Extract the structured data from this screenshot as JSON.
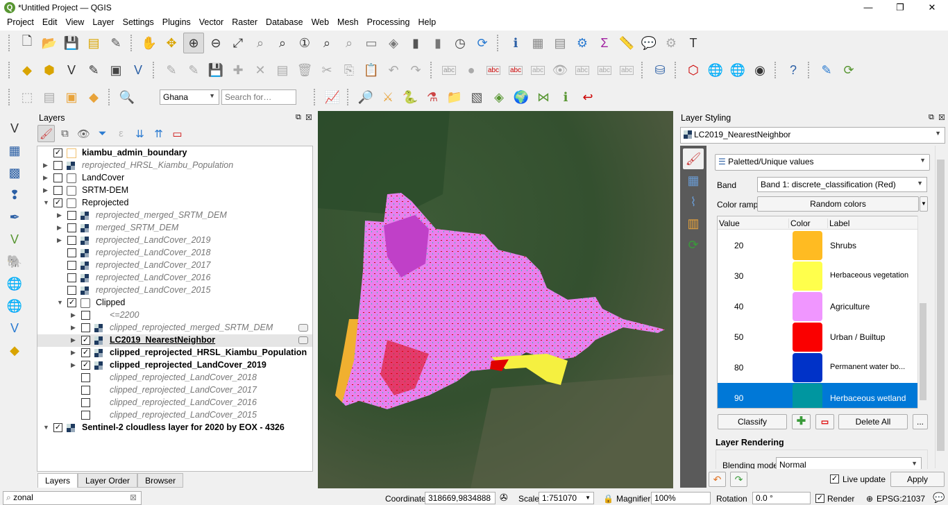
{
  "window": {
    "title": "*Untitled Project — QGIS",
    "minimize": "—",
    "maximize": "❐",
    "close": "✕"
  },
  "menu": [
    "Project",
    "Edit",
    "View",
    "Layer",
    "Settings",
    "Plugins",
    "Vector",
    "Raster",
    "Database",
    "Web",
    "Mesh",
    "Processing",
    "Help"
  ],
  "toolbars": [
    [
      {
        "icon": "new-project-icon",
        "g": "🗋",
        "c": "#333"
      },
      {
        "icon": "open-project-icon",
        "g": "📂",
        "c": "#e8a33a"
      },
      {
        "icon": "save-project-icon",
        "g": "💾",
        "c": "#3b6ea5"
      },
      {
        "icon": "new-print-layout-icon",
        "g": "▤",
        "c": "#d9a400"
      },
      {
        "icon": "layout-manager-icon",
        "g": "✎",
        "c": "#555"
      },
      {
        "sep": 1
      },
      {
        "icon": "pan-icon",
        "g": "✋",
        "c": "#333"
      },
      {
        "icon": "pan-to-selection-icon",
        "g": "✥",
        "c": "#d9a400"
      },
      {
        "icon": "zoom-in-icon",
        "g": "⊕",
        "c": "#333",
        "sel": 1
      },
      {
        "icon": "zoom-out-icon",
        "g": "⊖",
        "c": "#333"
      },
      {
        "icon": "zoom-full-icon",
        "g": "⤢",
        "c": "#333"
      },
      {
        "icon": "zoom-selection-icon",
        "g": "⌕",
        "c": "#888"
      },
      {
        "icon": "zoom-layer-icon",
        "g": "⌕",
        "c": "#333"
      },
      {
        "icon": "zoom-native-icon",
        "g": "①",
        "c": "#333"
      },
      {
        "icon": "zoom-last-icon",
        "g": "⌕",
        "c": "#333"
      },
      {
        "icon": "zoom-next-icon",
        "g": "⌕",
        "c": "#999"
      },
      {
        "icon": "new-map-view-icon",
        "g": "▭",
        "c": "#777"
      },
      {
        "icon": "new-3d-view-icon",
        "g": "◈",
        "c": "#777"
      },
      {
        "icon": "bookmark-icon",
        "g": "▮",
        "c": "#555"
      },
      {
        "icon": "show-bookmarks-icon",
        "g": "▮",
        "c": "#777"
      },
      {
        "icon": "temporal-icon",
        "g": "◷",
        "c": "#444"
      },
      {
        "icon": "refresh-icon",
        "g": "⟳",
        "c": "#2b7bd1"
      },
      {
        "sep": 1
      },
      {
        "icon": "identify-icon",
        "g": "ℹ",
        "c": "#2b5fa5"
      },
      {
        "icon": "attribute-table-icon",
        "g": "▦",
        "c": "#888"
      },
      {
        "icon": "field-calculator-icon",
        "g": "▤",
        "c": "#888"
      },
      {
        "icon": "settings-gear-icon",
        "g": "⚙",
        "c": "#2b7bd1"
      },
      {
        "icon": "statistics-sigma-icon",
        "g": "Σ",
        "c": "#a020a0"
      },
      {
        "icon": "measure-icon",
        "g": "📏",
        "c": "#555"
      },
      {
        "icon": "annotation-icon",
        "g": "💬",
        "c": "#e8d44d"
      },
      {
        "icon": "spatial-query-icon",
        "g": "⚙",
        "c": "#aaa"
      },
      {
        "icon": "text-annotation-icon",
        "g": "T",
        "c": "#333"
      }
    ],
    [
      {
        "icon": "data-source-manager-icon",
        "g": "◆",
        "c": "#d9a400"
      },
      {
        "icon": "new-geopackage-icon",
        "g": "⬢",
        "c": "#d9a400"
      },
      {
        "icon": "digitize-vertex-icon",
        "g": "V",
        "c": "#333"
      },
      {
        "icon": "digitize-icon",
        "g": "✎",
        "c": "#333"
      },
      {
        "icon": "gps-icon",
        "g": "▣",
        "c": "#444"
      },
      {
        "icon": "virtual-layer-icon",
        "g": "V",
        "c": "#2b5fa5"
      },
      {
        "sep": 1
      },
      {
        "icon": "current-edits-icon",
        "g": "✎",
        "c": "#aaa"
      },
      {
        "icon": "toggle-editing-icon",
        "g": "✎",
        "c": "#aaa"
      },
      {
        "icon": "save-edits-icon",
        "g": "💾",
        "c": "#aaa"
      },
      {
        "icon": "add-feature-icon",
        "g": "✚",
        "c": "#aaa"
      },
      {
        "icon": "vertex-tool-icon",
        "g": "✕",
        "c": "#aaa"
      },
      {
        "icon": "modify-attributes-icon",
        "g": "▤",
        "c": "#aaa"
      },
      {
        "icon": "delete-selected-icon",
        "g": "🗑",
        "c": "#aaa"
      },
      {
        "icon": "cut-icon",
        "g": "✂",
        "c": "#aaa"
      },
      {
        "icon": "copy-icon",
        "g": "⎘",
        "c": "#aaa"
      },
      {
        "icon": "paste-icon",
        "g": "📋",
        "c": "#aaa"
      },
      {
        "icon": "undo-icon",
        "g": "↶",
        "c": "#aaa"
      },
      {
        "icon": "redo-icon",
        "g": "↷",
        "c": "#aaa"
      },
      {
        "sep": 1
      },
      {
        "icon": "label-toolbar-icon",
        "g": "abc",
        "c": "#999"
      },
      {
        "icon": "label-pin-icon",
        "g": "●",
        "c": "#aaa"
      },
      {
        "icon": "layer-labeling-icon",
        "g": "abc",
        "c": "#c00"
      },
      {
        "icon": "label-highlight-icon",
        "g": "abc",
        "c": "#c00"
      },
      {
        "icon": "pin-labels-icon",
        "g": "abc",
        "c": "#aaa"
      },
      {
        "icon": "show-hide-labels-icon",
        "g": "👁",
        "c": "#aaa"
      },
      {
        "icon": "move-label-icon",
        "g": "abc",
        "c": "#aaa"
      },
      {
        "icon": "rotate-label-icon",
        "g": "abc",
        "c": "#aaa"
      },
      {
        "icon": "change-label-icon",
        "g": "abc",
        "c": "#aaa"
      },
      {
        "sep": 1
      },
      {
        "icon": "db-manager-icon",
        "g": "⛁",
        "c": "#2b5fa5"
      },
      {
        "sep": 1
      },
      {
        "icon": "topology-checker-icon",
        "g": "⬡",
        "c": "#c00"
      },
      {
        "icon": "geocoding-icon",
        "g": "🌐",
        "c": "#2b7bd1"
      },
      {
        "icon": "zoom-web-icon",
        "g": "🌐",
        "c": "#2b7bd1"
      },
      {
        "icon": "plugin-icon",
        "g": "◉",
        "c": "#333"
      },
      {
        "sep": 1
      },
      {
        "icon": "help-icon",
        "g": "?",
        "c": "#2b5fa5"
      },
      {
        "sep": 1
      },
      {
        "icon": "georeferencer-icon",
        "g": "✎",
        "c": "#2b7bd1"
      },
      {
        "icon": "raster-refresh-icon",
        "g": "⟳",
        "c": "#589632"
      }
    ],
    [
      {
        "icon": "select-features-icon",
        "g": "⬚",
        "c": "#aaa"
      },
      {
        "icon": "select-attribute-icon",
        "g": "▤",
        "c": "#aaa"
      },
      {
        "icon": "deselect-icon",
        "g": "▣",
        "c": "#e8a33a"
      },
      {
        "icon": "select-location-icon",
        "g": "◆",
        "c": "#e8a33a"
      },
      {
        "sep": 1
      },
      {
        "icon": "search-zoom-icon",
        "g": "🔍",
        "c": "#2b7bd1"
      }
    ],
    [
      {
        "icon": "profile-tool-icon",
        "g": "📈",
        "c": "#a020a0"
      },
      {
        "sep": 1
      },
      {
        "icon": "search-plugin-icon",
        "g": "🔎",
        "c": "#589632"
      },
      {
        "icon": "semi-auto-classification-icon",
        "g": "⚔",
        "c": "#e8a33a"
      },
      {
        "icon": "python-console-icon",
        "g": "🐍",
        "c": "#2b5fa5"
      },
      {
        "icon": "processing-model-icon",
        "g": "⚗",
        "c": "#c44"
      },
      {
        "icon": "folder-plugin-icon",
        "g": "📁",
        "c": "#e8a33a"
      },
      {
        "icon": "georef-plugin-icon",
        "g": "▧",
        "c": "#555"
      },
      {
        "icon": "layers-plugin-icon",
        "g": "◈",
        "c": "#589632"
      },
      {
        "icon": "earth-engine-icon",
        "g": "🌍",
        "c": "#2b5fa5"
      },
      {
        "icon": "bowtie-icon",
        "g": "⋈",
        "c": "#589632"
      },
      {
        "icon": "identify-plugin-icon",
        "g": "ℹ",
        "c": "#589632"
      },
      {
        "icon": "curve-plugin-icon",
        "g": "↩",
        "c": "#c00"
      }
    ]
  ],
  "search_toolbar": {
    "location": "Ghana",
    "search_placeholder": "Search for…"
  },
  "left_toolbar": [
    {
      "icon": "add-vector-layer-icon",
      "g": "V",
      "c": "#333"
    },
    {
      "icon": "add-raster-layer-icon",
      "g": "▦",
      "c": "#2b5fa5"
    },
    {
      "icon": "add-mesh-layer-icon",
      "g": "▩",
      "c": "#2b5fa5"
    },
    {
      "icon": "add-delimited-text-icon",
      "g": "❢",
      "c": "#2b5fa5"
    },
    {
      "icon": "add-spatialite-icon",
      "g": "✒",
      "c": "#2b5fa5"
    },
    {
      "icon": "add-virtual-layer-icon",
      "g": "V",
      "c": "#589632"
    },
    {
      "icon": "add-postgis-icon",
      "g": "🐘",
      "c": "#2b5fa5"
    },
    {
      "icon": "add-wms-icon",
      "g": "🌐",
      "c": "#2b7bd1"
    },
    {
      "icon": "add-wcs-icon",
      "g": "🌐",
      "c": "#2b7bd1"
    },
    {
      "icon": "add-wfs-icon",
      "g": "V",
      "c": "#2b7bd1"
    },
    {
      "icon": "new-layer-icon",
      "g": "◆",
      "c": "#d9a400"
    }
  ],
  "layers_panel": {
    "title": "Layers",
    "tools": [
      {
        "icon": "style-manager-icon",
        "g": "🖌",
        "c": "#c44"
      },
      {
        "icon": "add-group-icon",
        "g": "⧉",
        "c": "#555"
      },
      {
        "icon": "manage-visibility-icon",
        "g": "👁",
        "c": "#666"
      },
      {
        "icon": "filter-legend-icon",
        "g": "⏷",
        "c": "#2b7bd1"
      },
      {
        "icon": "filter-expression-icon",
        "g": "ε",
        "c": "#bbb"
      },
      {
        "icon": "expand-all-icon",
        "g": "⇊",
        "c": "#2b7bd1"
      },
      {
        "icon": "collapse-all-icon",
        "g": "⇈",
        "c": "#2b7bd1"
      },
      {
        "icon": "remove-layer-icon",
        "g": "▭",
        "c": "#c00"
      }
    ],
    "items": [
      {
        "label": "kiambu_admin_boundary",
        "level": 0,
        "checked": true,
        "arrow": "",
        "type": "vector",
        "style": "bold"
      },
      {
        "label": "reprojected_HRSL_Kiambu_Population",
        "level": 0,
        "checked": false,
        "arrow": "right",
        "type": "raster",
        "style": "ital"
      },
      {
        "label": "LandCover",
        "level": 0,
        "checked": false,
        "arrow": "right",
        "type": "group",
        "style": ""
      },
      {
        "label": "SRTM-DEM",
        "level": 0,
        "checked": false,
        "arrow": "right",
        "type": "group",
        "style": ""
      },
      {
        "label": "Reprojected",
        "level": 0,
        "checked": true,
        "arrow": "down",
        "type": "group",
        "style": ""
      },
      {
        "label": "reprojected_merged_SRTM_DEM",
        "level": 1,
        "checked": false,
        "arrow": "right",
        "type": "raster",
        "style": "ital"
      },
      {
        "label": "merged_SRTM_DEM",
        "level": 1,
        "checked": false,
        "arrow": "right",
        "type": "raster",
        "style": "ital"
      },
      {
        "label": "reprojected_LandCover_2019",
        "level": 1,
        "checked": false,
        "arrow": "right",
        "type": "raster",
        "style": "ital"
      },
      {
        "label": "reprojected_LandCover_2018",
        "level": 1,
        "checked": false,
        "arrow": "",
        "type": "raster",
        "style": "ital"
      },
      {
        "label": "reprojected_LandCover_2017",
        "level": 1,
        "checked": false,
        "arrow": "",
        "type": "raster",
        "style": "ital"
      },
      {
        "label": "reprojected_LandCover_2016",
        "level": 1,
        "checked": false,
        "arrow": "",
        "type": "raster",
        "style": "ital"
      },
      {
        "label": "reprojected_LandCover_2015",
        "level": 1,
        "checked": false,
        "arrow": "",
        "type": "raster",
        "style": "ital"
      },
      {
        "label": "Clipped",
        "level": 1,
        "checked": true,
        "arrow": "down",
        "type": "group",
        "style": ""
      },
      {
        "label": "<=2200",
        "level": 2,
        "checked": false,
        "arrow": "right",
        "type": "none",
        "style": "ital"
      },
      {
        "label": "clipped_reprojected_merged_SRTM_DEM",
        "level": 2,
        "checked": false,
        "arrow": "right",
        "type": "raster",
        "style": "ital",
        "badge": true
      },
      {
        "label": "LC2019_NearestNeighbor",
        "level": 2,
        "checked": true,
        "arrow": "right",
        "type": "raster",
        "style": "bold",
        "badge": true,
        "selected": true
      },
      {
        "label": "clipped_reprojected_HRSL_Kiambu_Population",
        "level": 2,
        "checked": true,
        "arrow": "right",
        "type": "raster",
        "style": "bold"
      },
      {
        "label": "clipped_reprojected_LandCover_2019",
        "level": 2,
        "checked": true,
        "arrow": "right",
        "type": "raster",
        "style": "bold"
      },
      {
        "label": "clipped_reprojected_LandCover_2018",
        "level": 2,
        "checked": false,
        "arrow": "",
        "type": "none",
        "style": "ital"
      },
      {
        "label": "clipped_reprojected_LandCover_2017",
        "level": 2,
        "checked": false,
        "arrow": "",
        "type": "none",
        "style": "ital"
      },
      {
        "label": "clipped_reprojected_LandCover_2016",
        "level": 2,
        "checked": false,
        "arrow": "",
        "type": "none",
        "style": "ital"
      },
      {
        "label": "clipped_reprojected_LandCover_2015",
        "level": 2,
        "checked": false,
        "arrow": "",
        "type": "none",
        "style": "ital"
      },
      {
        "label": "Sentinel-2 cloudless layer for 2020 by EOX - 4326",
        "level": 0,
        "checked": true,
        "arrow": "down",
        "type": "raster",
        "style": "bold"
      }
    ],
    "tabs": [
      "Layers",
      "Layer Order",
      "Browser"
    ],
    "active_tab": "Layers"
  },
  "styling_panel": {
    "title": "Layer Styling",
    "layer": "LC2019_NearestNeighbor",
    "renderer": "Paletted/Unique values",
    "band_label": "Band",
    "band": "Band 1: discrete_classification (Red)",
    "color_ramp_label": "Color ramp",
    "color_ramp": "Random colors",
    "columns": [
      "Value",
      "Color",
      "Label"
    ],
    "classes": [
      {
        "value": "20",
        "color": "#ffbb22",
        "label": "Shrubs"
      },
      {
        "value": "30",
        "color": "#ffff4c",
        "label": "Herbaceous vegetation"
      },
      {
        "value": "40",
        "color": "#f096ff",
        "label": "Agriculture"
      },
      {
        "value": "50",
        "color": "#fa0000",
        "label": "Urban / Builtup"
      },
      {
        "value": "80",
        "color": "#0032c8",
        "label": "Permanent water bo..."
      },
      {
        "value": "90",
        "color": "#0096a0",
        "label": "Herbaceous wetland",
        "selected": true
      }
    ],
    "classify": "Classify",
    "delete_all": "Delete All",
    "more": "...",
    "rendering_title": "Layer Rendering",
    "blending_label": "Blending mode",
    "blending": "Normal",
    "live_update": "Live update",
    "live_update_checked": true,
    "apply": "Apply"
  },
  "statusbar": {
    "locator": "zonal",
    "coordinate_label": "Coordinate",
    "coordinate": "318669,9834888",
    "scale_label": "Scale",
    "scale": "1:751070",
    "magnifier_label": "Magnifier",
    "magnifier": "100%",
    "rotation_label": "Rotation",
    "rotation": "0.0 °",
    "render_label": "Render",
    "crs": "EPSG:21037"
  }
}
